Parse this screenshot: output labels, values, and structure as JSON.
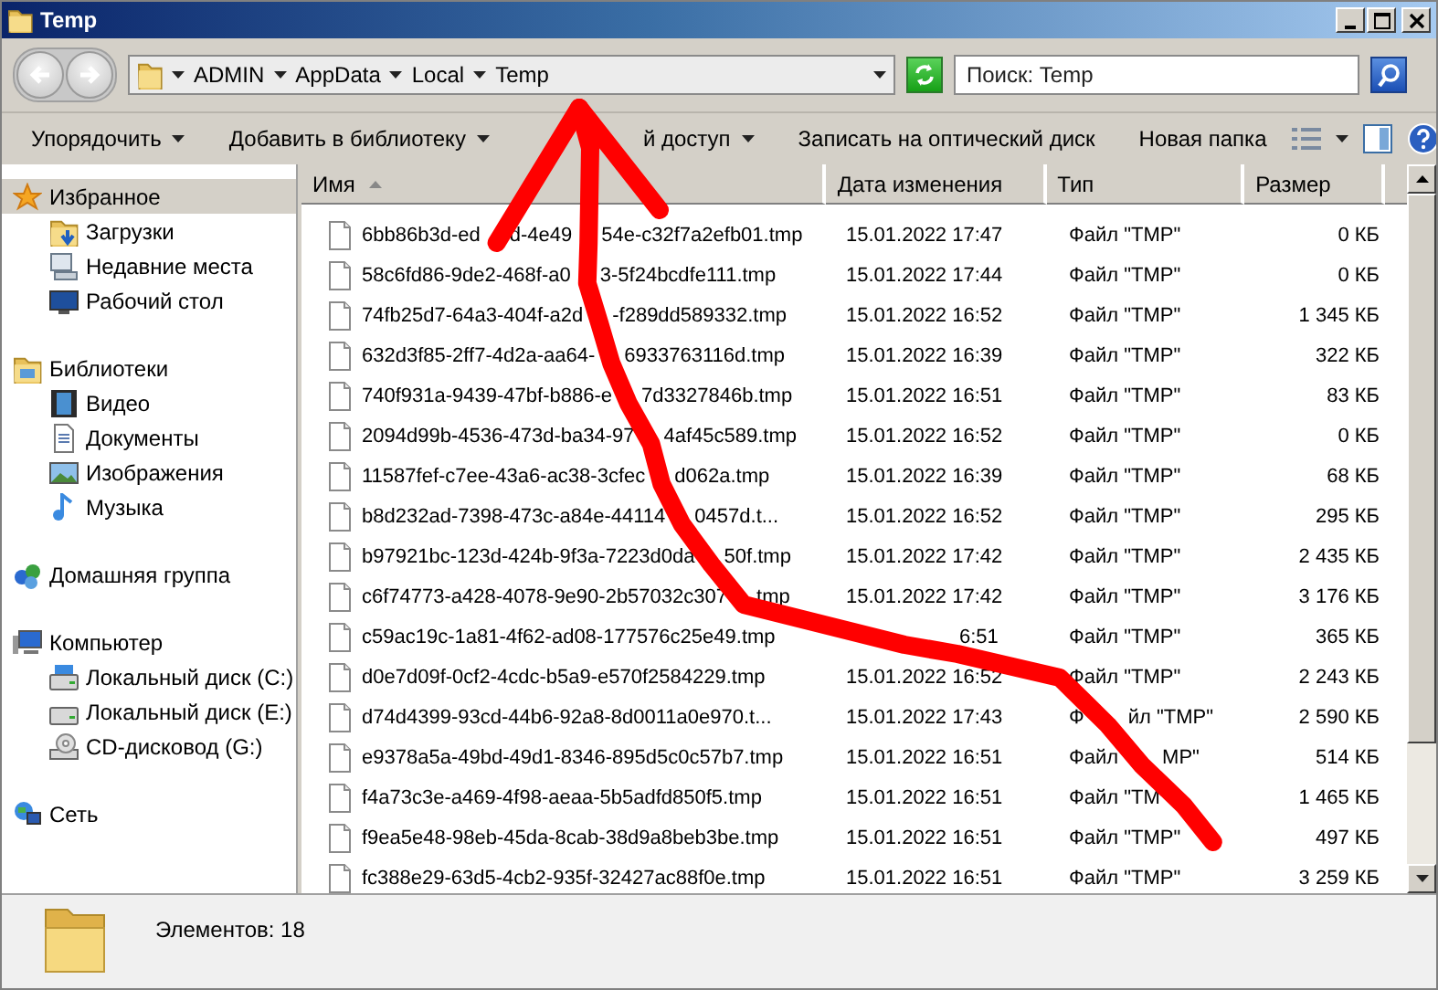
{
  "window": {
    "title": "Temp"
  },
  "address_bar": {
    "crumbs": [
      "ADMIN",
      "AppData",
      "Local",
      "Temp"
    ]
  },
  "search": {
    "placeholder": "Поиск: Temp"
  },
  "toolbar": {
    "items": [
      {
        "label": [
          "Упорядочить"
        ],
        "dropdown": true
      },
      {
        "label": [
          "Добавить в библиотеку"
        ],
        "dropdown": true
      },
      {
        "label": [
          "й доступ"
        ],
        "covered_start": true,
        "dropdown": true
      },
      {
        "label": [
          "Записать на оптический диск"
        ],
        "dropdown": false
      },
      {
        "label": [
          "Новая папка"
        ],
        "dropdown": false
      }
    ]
  },
  "sidebar": {
    "groups": [
      {
        "label": "Избранное",
        "selected": true,
        "children": [
          {
            "label": "Загрузки",
            "selected": false
          },
          {
            "label": "Недавние места",
            "selected": false
          },
          {
            "label": "Рабочий стол",
            "selected": false
          }
        ]
      },
      {
        "label": "Библиотеки",
        "selected": false,
        "children": [
          {
            "label": "Видео",
            "selected": false
          },
          {
            "label": "Документы",
            "selected": false
          },
          {
            "label": "Изображения",
            "selected": false
          },
          {
            "label": "Музыка",
            "selected": false
          }
        ]
      },
      {
        "label": "Домашняя группа",
        "selected": false
      },
      {
        "label": "Компьютер",
        "selected": false,
        "children": [
          {
            "label": "Локальный диск (C:)",
            "selected": false
          },
          {
            "label": "Локальный диск (E:)",
            "selected": false
          },
          {
            "label": "CD-дисковод (G:)",
            "selected": false
          }
        ]
      },
      {
        "label": "Сеть",
        "selected": false
      }
    ]
  },
  "table": {
    "columns": [
      {
        "label": "Имя",
        "sorted": true
      },
      {
        "label": "Дата изменения",
        "sorted": false
      },
      {
        "label": "Тип",
        "sorted": false
      },
      {
        "label": "Размер",
        "sorted": false
      }
    ],
    "rows": [
      {
        "name": [
          "6bb86b3d-ed",
          "d-4e49",
          "54e-c32f7a2efb01.tmp"
        ],
        "date": [
          "15.01.2022 17:47"
        ],
        "type": [
          "Файл \"TMP\""
        ],
        "size": "0 КБ"
      },
      {
        "name": [
          "58c6fd86-9de2-468f-a0",
          "3-5f24bcdfe111.tmp"
        ],
        "date": [
          "15.01.2022 17:44"
        ],
        "type": [
          "Файл \"TMP\""
        ],
        "size": "0 КБ"
      },
      {
        "name": [
          "74fb25d7-64a3-404f-a2d",
          "-f289dd589332.tmp"
        ],
        "date": [
          "15.01.2022 16:52"
        ],
        "type": [
          "Файл \"TMP\""
        ],
        "size": "1 345 КБ"
      },
      {
        "name": [
          "632d3f85-2ff7-4d2a-aa64-",
          "6933763116d.tmp"
        ],
        "date": [
          "15.01.2022 16:39"
        ],
        "type": [
          "Файл \"TMP\""
        ],
        "size": "322 КБ"
      },
      {
        "name": [
          "740f931a-9439-47bf-b886-e",
          "7d3327846b.tmp"
        ],
        "date": [
          "15.01.2022 16:51"
        ],
        "type": [
          "Файл \"TMP\""
        ],
        "size": "83 КБ"
      },
      {
        "name": [
          "2094d99b-4536-473d-ba34-97",
          "4af45c589.tmp"
        ],
        "date": [
          "15.01.2022 16:52"
        ],
        "type": [
          "Файл \"TMP\""
        ],
        "size": "0 КБ"
      },
      {
        "name": [
          "11587fef-c7ee-43a6-ac38-3cfec",
          "d062a.tmp"
        ],
        "date": [
          "15.01.2022 16:39"
        ],
        "type": [
          "Файл \"TMP\""
        ],
        "size": "68 КБ"
      },
      {
        "name": [
          "b8d232ad-7398-473c-a84e-44114",
          "0457d.t..."
        ],
        "date": [
          "15.01.2022 16:52"
        ],
        "type": [
          "Файл \"TMP\""
        ],
        "size": "295 КБ"
      },
      {
        "name": [
          "b97921bc-123d-424b-9f3a-7223d0da",
          "50f.tmp"
        ],
        "date": [
          "15.01.2022 17:42"
        ],
        "type": [
          "Файл \"TMP\""
        ],
        "size": "2 435 КБ"
      },
      {
        "name": [
          "c6f74773-a428-4078-9e90-2b57032c307",
          "tmp"
        ],
        "date": [
          "15.01.2022 17:42"
        ],
        "type": [
          "Файл \"TMP\""
        ],
        "size": "3 176 КБ"
      },
      {
        "name": [
          "c59ac19c-1a81-4f62-ad08-177576c25e49.tmp"
        ],
        "date": [
          "6:51"
        ],
        "date_covered_start": true,
        "type": [
          "Файл \"TMP\""
        ],
        "size": "365 КБ"
      },
      {
        "name": [
          "d0e7d09f-0cf2-4cdc-b5a9-e570f2584229.tmp"
        ],
        "date": [
          "15.01.2022 16:52"
        ],
        "type": [
          "Файл \"TMP\""
        ],
        "size": "2 243 КБ"
      },
      {
        "name": [
          "d74d4399-93cd-44b6-92a8-8d0011a0e970.t..."
        ],
        "date": [
          "15.01.2022 17:43"
        ],
        "type": [
          "Ф",
          "йл \"TMP\""
        ],
        "size": "2 590 КБ"
      },
      {
        "name": [
          "e9378a5a-49bd-49d1-8346-895d5c0c57b7.tmp"
        ],
        "date": [
          "15.01.2022 16:51"
        ],
        "type": [
          "Файл",
          "MP\""
        ],
        "size": "514 КБ"
      },
      {
        "name": [
          "f4a73c3e-a469-4f98-aeaa-5b5adfd850f5.tmp"
        ],
        "date": [
          "15.01.2022 16:51"
        ],
        "type": [
          "Файл \"TM"
        ],
        "type_covered_end": true,
        "size": "1 465 КБ"
      },
      {
        "name": [
          "f9ea5e48-98eb-45da-8cab-38d9a8beb3be.tmp"
        ],
        "date": [
          "15.01.2022 16:51"
        ],
        "type": [
          "Файл \"TMP\""
        ],
        "size": "497 КБ"
      },
      {
        "name": [
          "fc388e29-63d5-4cb2-935f-32427ac88f0e.tmp"
        ],
        "date": [
          "15.01.2022 16:51"
        ],
        "type": [
          "Файл \"TMP\""
        ],
        "size": "3 259 КБ"
      }
    ]
  },
  "status_bar": {
    "text": "Элементов: 18"
  }
}
